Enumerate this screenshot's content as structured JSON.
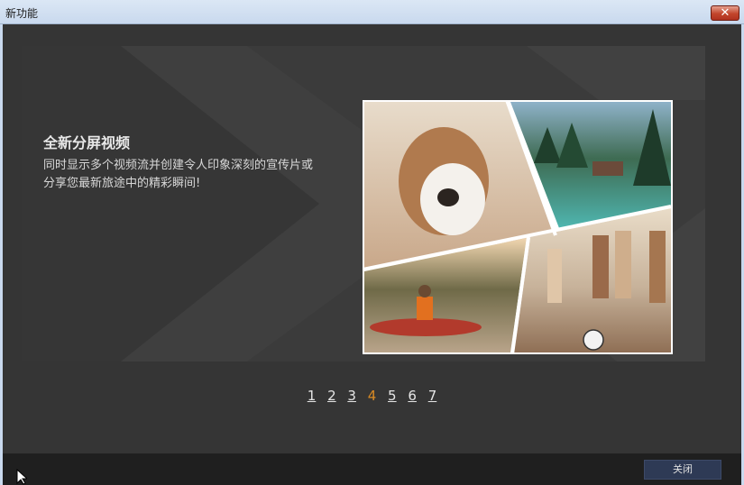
{
  "window": {
    "title": "新功能",
    "close_glyph": "✕"
  },
  "slide": {
    "title": "全新分屏视频",
    "description": "同时显示多个视频流并创建令人印象深刻的宣传片或分享您最新旅途中的精彩瞬间!",
    "image_icon": "split-screen-collage-image"
  },
  "pager": {
    "pages": [
      "1",
      "2",
      "3",
      "4",
      "5",
      "6",
      "7"
    ],
    "active_page": "4"
  },
  "footer": {
    "close_label": "关闭"
  },
  "colors": {
    "accent_active_page": "#d98a24",
    "panel_bg": "#3b3b3b",
    "window_bg": "#353535",
    "footer_button_bg": "#2e3a55"
  }
}
